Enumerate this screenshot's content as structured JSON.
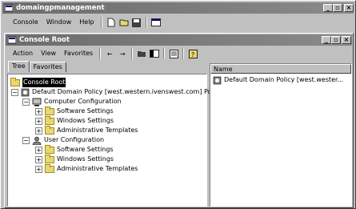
{
  "app": {
    "title": "domaingpmanagement"
  },
  "menu": {
    "console": "Console",
    "window": "Window",
    "help": "Help"
  },
  "child": {
    "title": "Console Root"
  },
  "action_menu": {
    "action": "Action",
    "view": "View",
    "favorites": "Favorites"
  },
  "tabs": {
    "tree": "Tree",
    "favorites": "Favorites"
  },
  "tree": {
    "root": "Console Root",
    "policy": "Default Domain Policy [west.western.ivenswest.com] Policy",
    "computer": "Computer Configuration",
    "user": "User Configuration",
    "software": "Software Settings",
    "windows": "Windows Settings",
    "admin": "Administrative Templates"
  },
  "right": {
    "col_name": "Name",
    "item": "Default Domain Policy [west.wester..."
  }
}
